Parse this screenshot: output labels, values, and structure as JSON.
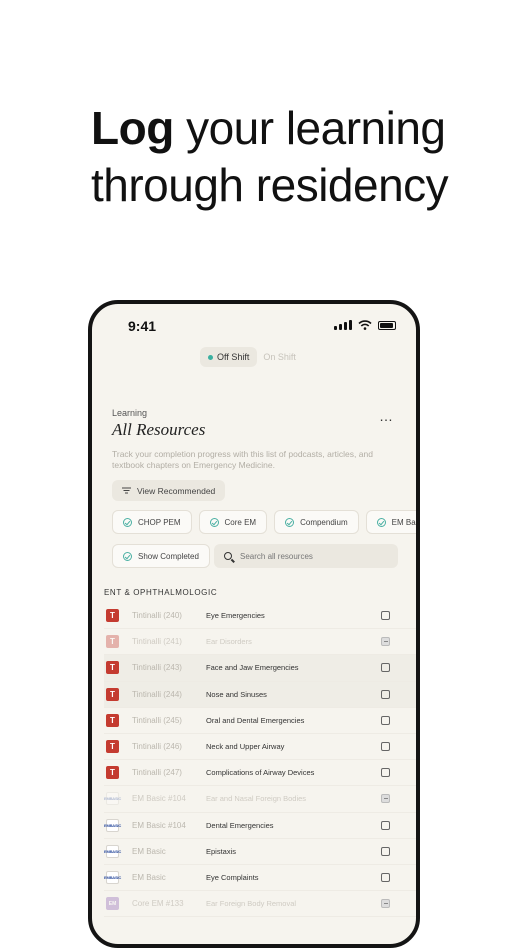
{
  "headline": {
    "bold": "Log",
    "rest": " your learning through residency"
  },
  "status_bar": {
    "time": "9:41"
  },
  "shift_toggle": {
    "active": "Off Shift",
    "inactive": "On Shift"
  },
  "page": {
    "section": "Learning",
    "title": "All Resources",
    "more_label": "…",
    "description": "Track your completion progress with this list of podcasts, articles, and textbook chapters on Emergency Medicine."
  },
  "buttons": {
    "view_recommended": "View Recommended",
    "show_completed": "Show Completed"
  },
  "filters": [
    "CHOP PEM",
    "Core EM",
    "Compendium",
    "EM Basic"
  ],
  "search": {
    "placeholder": "Search all resources"
  },
  "group": "ENT & OPHTHALMOLOGIC",
  "resources": [
    {
      "badge": "T",
      "badge_type": "tintinalli",
      "source": "Tintinalli (240)",
      "title": "Eye Emergencies",
      "completed": false,
      "shaded": false
    },
    {
      "badge": "T",
      "badge_type": "tintinalli",
      "source": "Tintinalli (241)",
      "title": "Ear Disorders",
      "completed": true,
      "shaded": false
    },
    {
      "badge": "T",
      "badge_type": "tintinalli",
      "source": "Tintinalli (243)",
      "title": "Face and Jaw Emergencies",
      "completed": false,
      "shaded": true
    },
    {
      "badge": "T",
      "badge_type": "tintinalli",
      "source": "Tintinalli (244)",
      "title": "Nose and Sinuses",
      "completed": false,
      "shaded": true
    },
    {
      "badge": "T",
      "badge_type": "tintinalli",
      "source": "Tintinalli (245)",
      "title": "Oral and Dental Emergencies",
      "completed": false,
      "shaded": false
    },
    {
      "badge": "T",
      "badge_type": "tintinalli",
      "source": "Tintinalli (246)",
      "title": "Neck and Upper Airway",
      "completed": false,
      "shaded": false
    },
    {
      "badge": "T",
      "badge_type": "tintinalli",
      "source": "Tintinalli (247)",
      "title": "Complications of Airway Devices",
      "completed": false,
      "shaded": false
    },
    {
      "badge": "EMBASIC",
      "badge_type": "embasic",
      "source": "EM Basic #104",
      "title": "Ear and Nasal Foreign Bodies",
      "completed": true,
      "shaded": false
    },
    {
      "badge": "EMBASIC",
      "badge_type": "embasic",
      "source": "EM Basic #104",
      "title": "Dental Emergencies",
      "completed": false,
      "shaded": false
    },
    {
      "badge": "EMBASIC",
      "badge_type": "embasic",
      "source": "EM Basic",
      "title": "Epistaxis",
      "completed": false,
      "shaded": false
    },
    {
      "badge": "EMBASIC",
      "badge_type": "embasic",
      "source": "EM Basic",
      "title": "Eye Complaints",
      "completed": false,
      "shaded": false
    },
    {
      "badge": "EM",
      "badge_type": "coreem",
      "source": "Core EM #133",
      "title": "Ear Foreign Body Removal",
      "completed": true,
      "shaded": false
    }
  ]
}
